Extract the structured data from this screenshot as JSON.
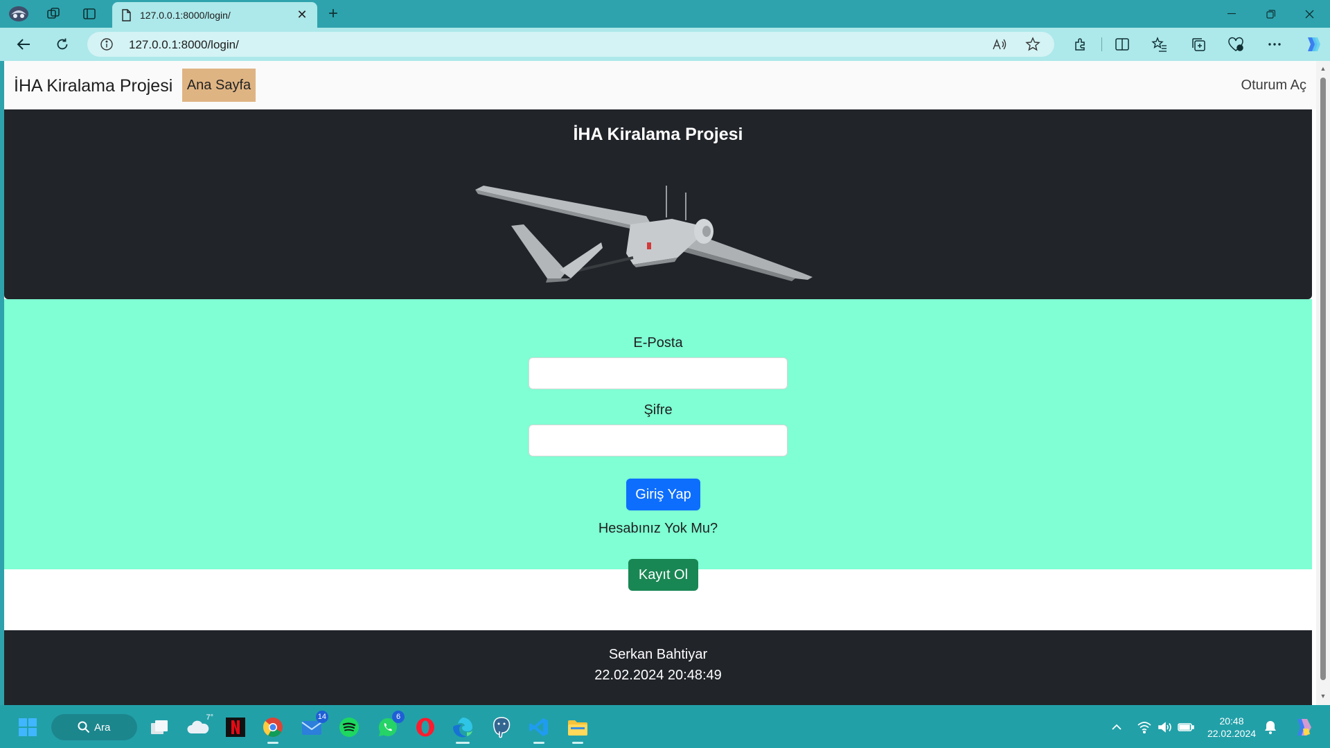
{
  "browser": {
    "tab_title": "127.0.0.1:8000/login/",
    "url": "127.0.0.1:8000/login/"
  },
  "page": {
    "navbar": {
      "brand": "İHA Kiralama Projesi",
      "home_link": "Ana Sayfa",
      "login_link": "Oturum Aç"
    },
    "hero": {
      "title": "İHA Kiralama Projesi"
    },
    "form": {
      "email_label": "E-Posta",
      "email_value": "",
      "password_label": "Şifre",
      "password_value": "",
      "login_button": "Giriş Yap",
      "no_account_text": "Hesabınız Yok Mu?",
      "register_button": "Kayıt Ol"
    },
    "footer": {
      "name": "Serkan Bahtiyar",
      "datetime": "22.02.2024 20:48:49"
    }
  },
  "taskbar": {
    "search_label": "Ara",
    "weather_temp": "7°",
    "mail_badge": "14",
    "whatsapp_badge": "6",
    "clock_time": "20:48",
    "clock_date": "22.02.2024"
  },
  "colors": {
    "browser_frame": "#2ea3ad",
    "toolbar": "#ade8ea",
    "nav_home_bg": "#dfb483",
    "hero_bg": "#212429",
    "main_bg": "#7fffd3",
    "login_btn": "#0d6efd",
    "register_btn": "#198754"
  }
}
